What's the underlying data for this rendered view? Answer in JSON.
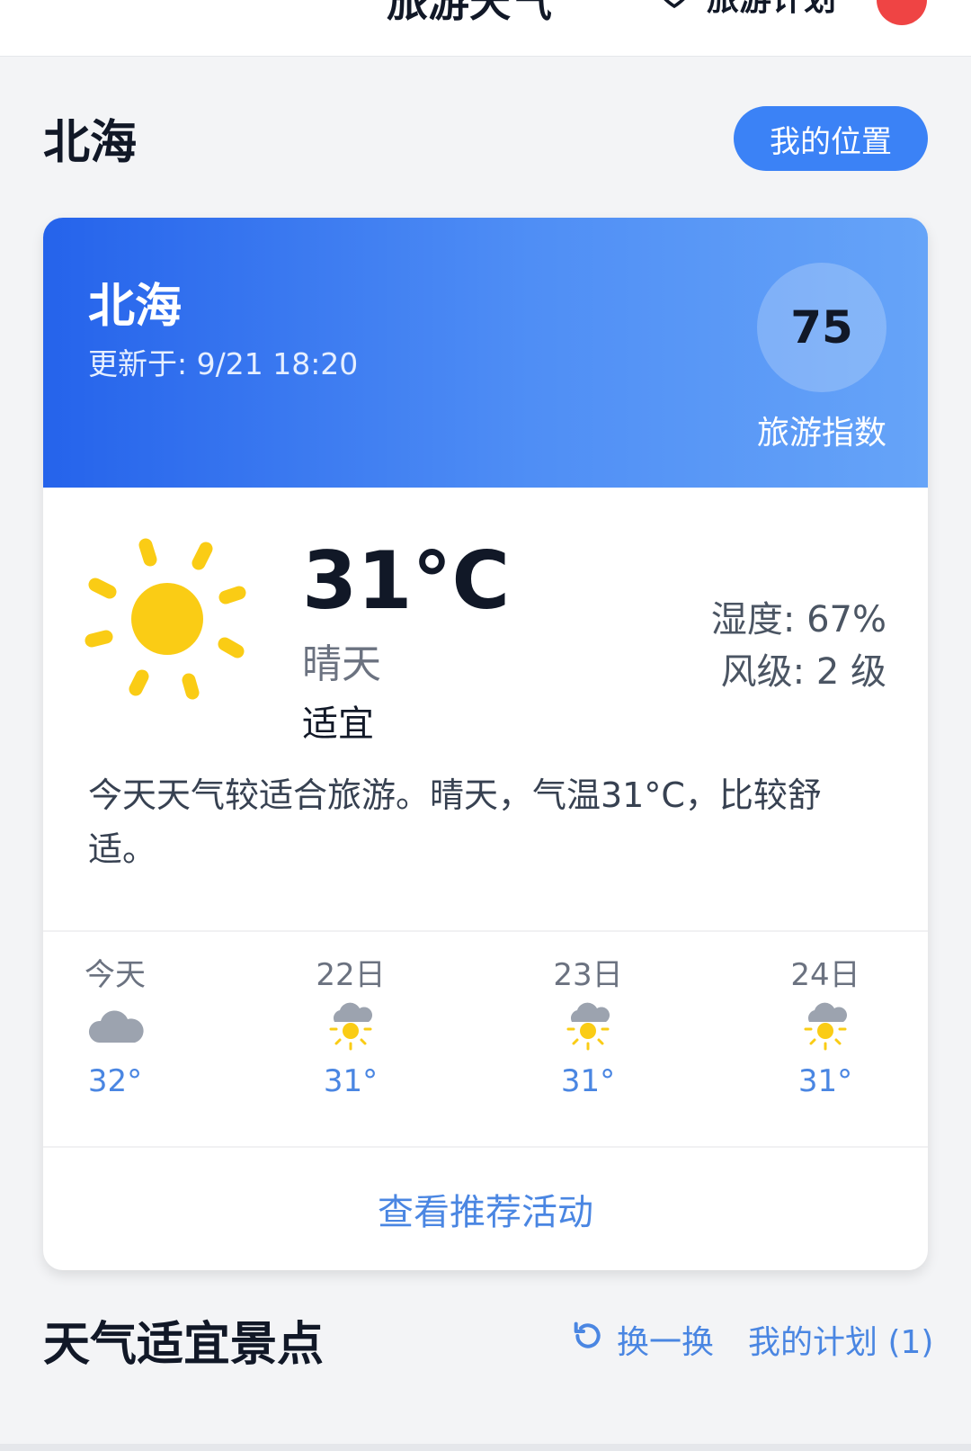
{
  "topbar": {
    "title": "旅游天气",
    "plan_label": "旅游计划",
    "icons": [
      "heart-icon"
    ]
  },
  "page": {
    "city": "北海",
    "location_button": "我的位置"
  },
  "card": {
    "city": "北海",
    "updated": "更新于: 9/21 18:20",
    "travel_index": "75",
    "travel_index_label": "旅游指数",
    "temperature": "31°C",
    "condition": "晴天",
    "suitability": "适宜",
    "humidity": "湿度: 67%",
    "wind": "风级: 2 级",
    "description": "今天天气较适合旅游。晴天，气温31°C，比较舒适。",
    "forecast": [
      {
        "day": "今天",
        "icon": "cloud-icon",
        "temp": "32°"
      },
      {
        "day": "22日",
        "icon": "sun-cloud-icon",
        "temp": "31°"
      },
      {
        "day": "23日",
        "icon": "sun-cloud-icon",
        "temp": "31°"
      },
      {
        "day": "24日",
        "icon": "sun-cloud-icon",
        "temp": "31°"
      }
    ],
    "activity_link": "查看推荐活动"
  },
  "section": {
    "title": "天气适宜景点",
    "refresh_label": "换一换",
    "my_plan_label": "我的计划 (1)"
  },
  "colors": {
    "accent": "#3b82f6",
    "link": "#4a86e2",
    "sun": "#facc15"
  }
}
